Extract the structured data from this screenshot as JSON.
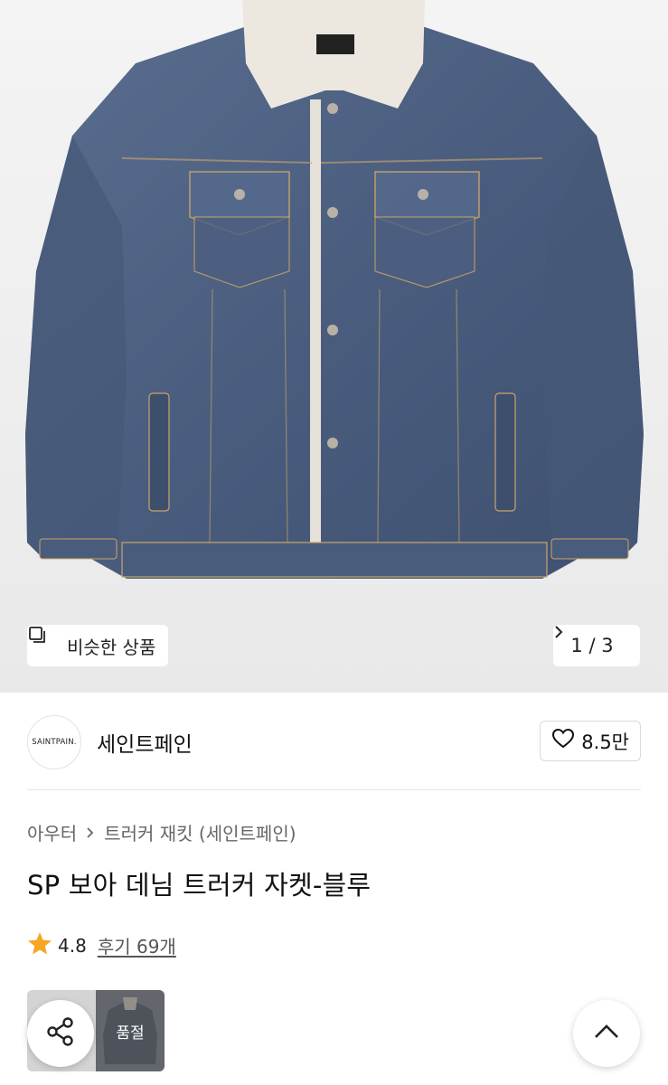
{
  "hero": {
    "product_image": "denim-boa-trucker-jacket-image",
    "similar_button": {
      "icon": "similar-items-icon",
      "label": "비슷한 상품"
    },
    "pager": {
      "label": "1 / 3",
      "icon": "chevron-right-icon"
    }
  },
  "brand": {
    "logo_text": "SAINTPAIN.",
    "name": "세인트페인",
    "like": {
      "icon": "heart-outline-icon",
      "count": "8.5만"
    }
  },
  "breadcrumb": {
    "category": "아우터",
    "separator_icon": "chevron-right-icon",
    "subcategory": "트러커 재킷 (세인트페인)"
  },
  "product": {
    "title": "SP 보아 데님 트러커 자켓-블루",
    "rating": {
      "icon": "star-icon",
      "score": "4.8",
      "reviews_label": "후기 69개"
    }
  },
  "thumbnails": {
    "items": [
      "thumbnail-1",
      "thumbnail-2"
    ],
    "soldout_label": "품절"
  },
  "fabs": {
    "share_icon": "share-icon",
    "scroll_top_icon": "chevron-up-icon"
  },
  "colors": {
    "star": "#f5a623",
    "hero_bg": "#eeeeee",
    "denim": "#4f6384"
  }
}
